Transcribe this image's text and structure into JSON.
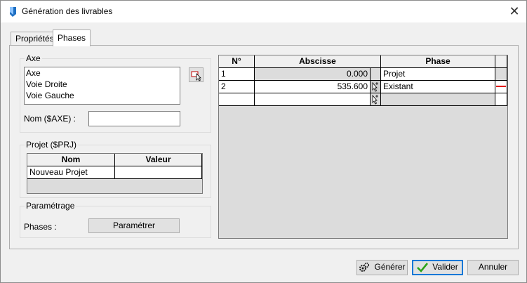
{
  "window": {
    "title": "Génération des livrables",
    "close_glyph": "✕"
  },
  "tabs": [
    {
      "label": "Propriétés",
      "active": false
    },
    {
      "label": "Phases",
      "active": true
    }
  ],
  "axe": {
    "title": "Axe",
    "items": [
      "Axe",
      "Voie Droite",
      "Voie Gauche"
    ],
    "pick_icon": "select-cursor-icon",
    "nom_label": "Nom ($AXE) :",
    "nom_value": ""
  },
  "projet": {
    "title": "Projet ($PRJ)",
    "headers": [
      "Nom",
      "Valeur"
    ],
    "rows": [
      {
        "nom": "Nouveau Projet",
        "valeur": ""
      }
    ]
  },
  "parametrage": {
    "title": "Paramétrage",
    "phases_label": "Phases :",
    "button": "Paramétrer"
  },
  "phases_grid": {
    "headers": [
      "N°",
      "Abscisse",
      "Phase"
    ],
    "rows": [
      {
        "n": "1",
        "abscisse": "0.000",
        "phase": "Projet",
        "color": ""
      },
      {
        "n": "2",
        "abscisse": "535.600",
        "phase": "Existant",
        "color": "#e00000"
      },
      {
        "n": "",
        "abscisse": "",
        "phase": "",
        "color": ""
      }
    ]
  },
  "footer": {
    "generer": "Générer",
    "valider": "Valider",
    "annuler": "Annuler"
  },
  "colors": {
    "accent": "#0078d7",
    "phase_marker_red": "#e00000",
    "check_green": "#2aa31a"
  }
}
